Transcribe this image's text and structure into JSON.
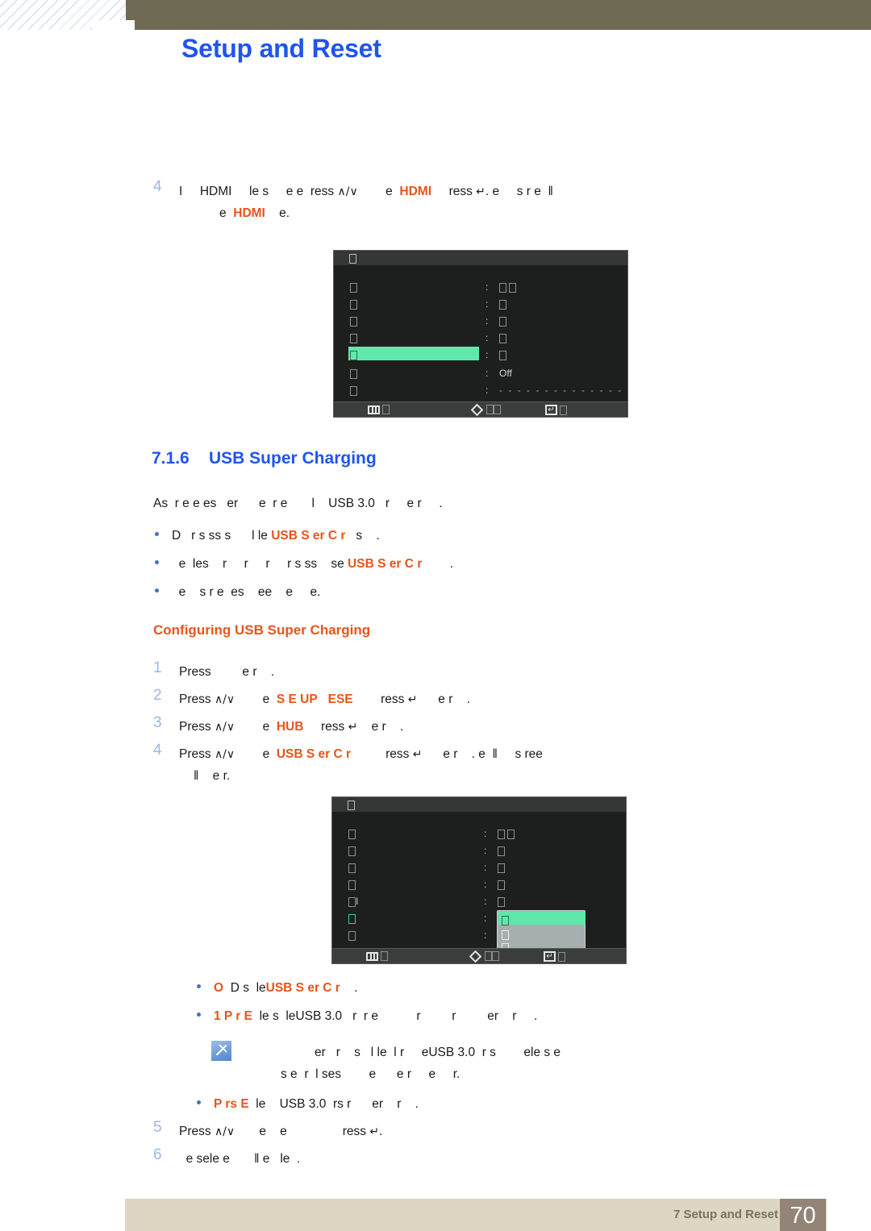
{
  "header": {
    "title": "Setup and Reset"
  },
  "steps_top": {
    "number": "4",
    "line1_a": "I",
    "line1_b": "HDMI",
    "line1_c": "le s",
    "line1_d": "e e",
    "line1_e": "ress",
    "line1_keys": "∧/∨",
    "line1_f": "e",
    "line1_g": "HDMI",
    "line1_h": "ress",
    "line1_enter": "↵",
    "line1_i": ". e",
    "line1_j": "s r e",
    "line1_k": "‖",
    "line2_a": "e",
    "line2_b": "HDMI",
    "line2_c": "e."
  },
  "osd1": {
    "title_glyph": "tofu",
    "rows": [
      {
        "label": "tofu",
        "value": "tofu tofu"
      },
      {
        "label": "tofu",
        "value": "tofu"
      },
      {
        "label": "tofu",
        "value": "tofu"
      },
      {
        "label": "tofu",
        "value": "tofu"
      },
      {
        "label": "tofu",
        "value": "tofu",
        "highlighted": true
      },
      {
        "label": "tofu",
        "value": "Off"
      },
      {
        "label": "tofu",
        "value": "- - - - - - - - - - - - - -"
      }
    ],
    "footer": {
      "menu_icon": "menu-grid-icon",
      "menu_label": "□",
      "move_icon": "diamond-navigate-icon",
      "move_label": "□□",
      "enter_icon": "enter-return-icon",
      "enter_label": "□"
    }
  },
  "section": {
    "number": "7.1.6",
    "title": "USB Super Charging",
    "intro_a": "As",
    "intro_b": "r e e es",
    "intro_c": "er",
    "intro_d": "e",
    "intro_e": "r e",
    "intro_f": "l",
    "intro_g": "USB 3.0",
    "intro_h": "r",
    "intro_i": "e r",
    "intro_j": "."
  },
  "bullets_intro": [
    {
      "a": "D",
      "b": "r s ss s",
      "c": "l le",
      "highlight": "USB S",
      "highlight2": "er C",
      "d": "r",
      "e": "s",
      "f": "."
    },
    {
      "a": "e",
      "b": "les",
      "c": "r",
      "d": "r",
      "e": "r",
      "f": "r s ss",
      "g": "se",
      "highlight": "USB S",
      "highlight2": "er C",
      "h": "r",
      "i": "."
    },
    {
      "a": "e",
      "b": "s r e",
      "c": "es",
      "d": "ee",
      "e": "e",
      "f": "e."
    }
  ],
  "subsection": {
    "title": "Configuring USB Super Charging"
  },
  "steps": [
    {
      "number": "1",
      "a": "Press",
      "b": "e r",
      "c": "."
    },
    {
      "number": "2",
      "a": "Press",
      "keys": "∧/∨",
      "b": "e",
      "highlight": "S E UP",
      "highlight2": "ESE",
      "c": "ress",
      "enter": "↵",
      "d": "e r",
      "e": "."
    },
    {
      "number": "3",
      "a": "Press",
      "keys": "∧/∨",
      "b": "e",
      "highlight": "HUB",
      "c": "ress",
      "enter": "↵",
      "d": "e r",
      "e": "."
    },
    {
      "number": "4",
      "a": "Press",
      "keys": "∧/∨",
      "b": "e",
      "highlight": "USB S",
      "highlight2": "er C",
      "bh3": "r",
      "c": "ress",
      "enter": "↵",
      "d": "e r",
      "e": ". e",
      "f": "‖",
      "g": "s ree",
      "line2_a": "‖",
      "line2_b": "e r."
    }
  ],
  "osd2": {
    "title_glyph": "tofu",
    "rows": [
      {
        "label": "tofu",
        "value": "tofu tofu"
      },
      {
        "label": "tofu",
        "value": "tofu"
      },
      {
        "label": "tofu",
        "value": "tofu"
      },
      {
        "label": "tofu",
        "value": "tofu"
      },
      {
        "label": "tofu-l",
        "value": "tofu"
      },
      {
        "label": "tofu-green",
        "value": "popup"
      },
      {
        "label": "tofu",
        "value": "popup"
      }
    ],
    "popup_items": [
      "tofu",
      "tofu",
      "tofu"
    ],
    "footer": {
      "menu_icon": "menu-grid-icon",
      "menu_label": "□",
      "move_icon": "diamond-navigate-icon",
      "move_label": "□□",
      "enter_icon": "enter-return-icon",
      "enter_label": "□"
    }
  },
  "bullets_bottom": [
    {
      "a": "O",
      "b": "D s",
      "c": "le",
      "highlight": "USB S",
      "highlight2": "er C",
      "d": "r",
      "e": "."
    },
    {
      "highlight": "1 P r E",
      "a": "le s",
      "b": "le",
      "c": "USB 3.0",
      "d": "r",
      "e": "r e",
      "f": "r",
      "g": "r",
      "h": "er",
      "i": "r",
      "j": "."
    }
  ],
  "note": {
    "icon": "note-pencil-icon",
    "line1_a": "er",
    "line1_b": "r",
    "line1_c": "s",
    "line1_d": "l le",
    "line1_e": "l r",
    "line1_f": "e",
    "line1_g": "USB 3.0",
    "line1_h": "r s",
    "line1_i": "ele s e",
    "line2_a": "s e",
    "line2_b": "r",
    "line2_c": "l ses",
    "line2_d": "e",
    "line2_e": "e r",
    "line2_f": "e",
    "line2_g": "r."
  },
  "bullet_after_note": {
    "highlight": "P rs E",
    "a": "le",
    "b": "USB 3.0",
    "c": "rs r",
    "d": "er",
    "e": "r",
    "f": "."
  },
  "steps_end": [
    {
      "number": "5",
      "a": "Press",
      "keys": "∧/∨",
      "b": "e",
      "c": "e",
      "d": "ress",
      "enter": "↵",
      "e": "."
    },
    {
      "number": "6",
      "a": "e sele e",
      "b": "‖ e",
      "c": "le",
      "d": "."
    }
  ],
  "footer": {
    "text": "7 Setup and Reset",
    "page_number": "70"
  },
  "colors": {
    "header_band": "#6e6a54",
    "title_blue": "#1f54ef",
    "accent_orange": "#e8541a",
    "step_number_blue": "#9bb7e8",
    "osd_highlight_green": "#5fe8ab",
    "footer_band": "#dcd6c2",
    "footer_pageno": "#938477"
  }
}
